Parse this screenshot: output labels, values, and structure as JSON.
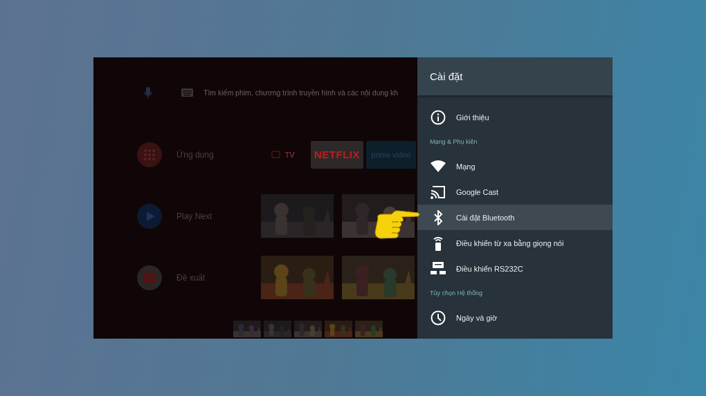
{
  "home": {
    "search": {
      "placeholder": "Tìm kiếm phim, chương trình truyền hình và các nội dung kh"
    },
    "rows": [
      {
        "kind": "apps",
        "label": "Ứng dụng",
        "tiles": [
          {
            "kind": "tv",
            "label": "TV"
          },
          {
            "kind": "netflix",
            "label": "NETFLIX"
          },
          {
            "kind": "prime",
            "label": "prime video"
          }
        ]
      },
      {
        "kind": "play_next",
        "label": "Play Next"
      },
      {
        "kind": "youtube",
        "label": "Đề xuất"
      },
      {
        "kind": "movies"
      }
    ]
  },
  "settings": {
    "title": "Cài đặt",
    "items": [
      {
        "kind": "info",
        "label": "Giới thiệu",
        "selected": false
      },
      {
        "kind": "section",
        "label": "Mạng & Phụ kiện"
      },
      {
        "kind": "wifi",
        "label": "Mạng",
        "selected": false
      },
      {
        "kind": "cast",
        "label": "Google Cast",
        "selected": false
      },
      {
        "kind": "bluetooth",
        "label": "Cài đặt Bluetooth",
        "selected": true
      },
      {
        "kind": "remote",
        "label": "Điều khiển từ xa bằng giọng nói",
        "selected": false
      },
      {
        "kind": "serial",
        "label": "Điều khiển RS232C",
        "selected": false
      },
      {
        "kind": "section",
        "label": "Tùy chọn Hệ thống"
      },
      {
        "kind": "clock",
        "label": "Ngày và giờ",
        "selected": false
      }
    ]
  }
}
